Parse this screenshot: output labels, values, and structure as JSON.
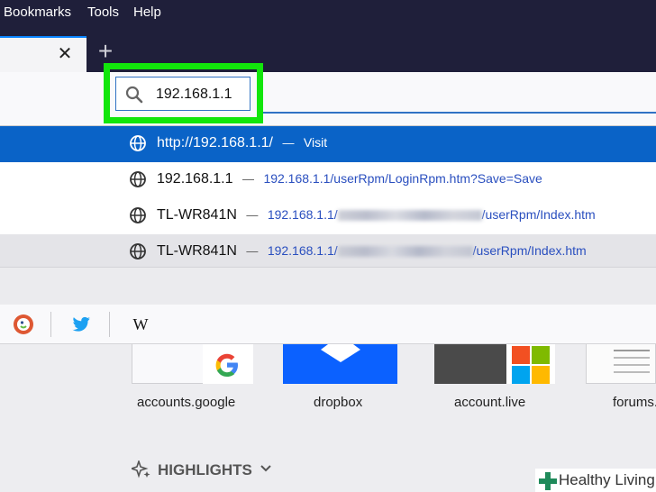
{
  "menu": {
    "bookmarks": "Bookmarks",
    "tools": "Tools",
    "help": "Help"
  },
  "tabs": {
    "close_symbol": "✕",
    "new_tab_symbol": "+"
  },
  "urlbar": {
    "value": "192.168.1.1"
  },
  "suggestions": [
    {
      "title": "http://192.168.1.1/",
      "separator": "—",
      "action": "Visit"
    },
    {
      "title": "192.168.1.1",
      "separator": "—",
      "url": "192.168.1.1/userRpm/LoginRpm.htm?Save=Save"
    },
    {
      "title": "TL-WR841N",
      "separator": "—",
      "url_prefix": "192.168.1.1/",
      "url_suffix": "/userRpm/Index.htm"
    },
    {
      "title": "TL-WR841N",
      "separator": "—",
      "url_prefix": "192.168.1.1/",
      "url_suffix": "/userRpm/Index.htm"
    }
  ],
  "search_engines": {
    "wikipedia_label": "W"
  },
  "top_sites": [
    {
      "label": "accounts.google"
    },
    {
      "label": "dropbox"
    },
    {
      "label": "account.live"
    },
    {
      "label": "forums.pee"
    }
  ],
  "sections": {
    "highlights": "HIGHLIGHTS"
  },
  "watermark": {
    "text": "Healthy Living"
  },
  "colors": {
    "menubar_bg": "#1f1f3a",
    "highlight_green": "#12e60b",
    "selected_row": "#0a63c7",
    "link_blue": "#2a4fbf"
  }
}
